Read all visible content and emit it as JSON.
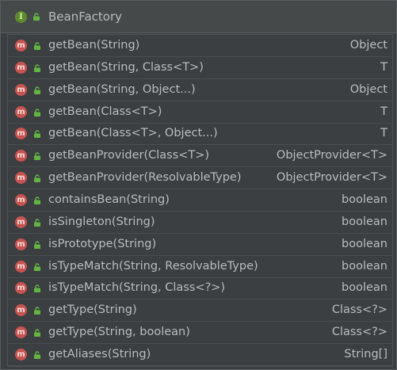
{
  "header": {
    "badge": "I",
    "title": "BeanFactory"
  },
  "method_badge": "m",
  "rows": [
    {
      "method": "getBean(String)",
      "returns": "Object"
    },
    {
      "method": "getBean(String, Class<T>)",
      "returns": "T"
    },
    {
      "method": "getBean(String, Object...)",
      "returns": "Object"
    },
    {
      "method": "getBean(Class<T>)",
      "returns": "T"
    },
    {
      "method": "getBean(Class<T>, Object...)",
      "returns": "T"
    },
    {
      "method": "getBeanProvider(Class<T>)",
      "returns": "ObjectProvider<T>"
    },
    {
      "method": "getBeanProvider(ResolvableType)",
      "returns": "ObjectProvider<T>"
    },
    {
      "method": "containsBean(String)",
      "returns": "boolean"
    },
    {
      "method": "isSingleton(String)",
      "returns": "boolean"
    },
    {
      "method": "isPrototype(String)",
      "returns": "boolean"
    },
    {
      "method": "isTypeMatch(String, ResolvableType)",
      "returns": "boolean"
    },
    {
      "method": "isTypeMatch(String, Class<?>)",
      "returns": "boolean"
    },
    {
      "method": "getType(String)",
      "returns": "Class<?>"
    },
    {
      "method": "getType(String, boolean)",
      "returns": "Class<?>"
    },
    {
      "method": "getAliases(String)",
      "returns": "String[]"
    }
  ],
  "colors": {
    "background": "#3c3f41",
    "text": "#b9bcbf",
    "method_badge": "#c75450",
    "interface_badge": "#5e8a2c",
    "public_lock": "#62b543"
  },
  "icons": {
    "interface": "interface-icon",
    "method": "method-icon",
    "visibility": "public-lock-icon"
  }
}
